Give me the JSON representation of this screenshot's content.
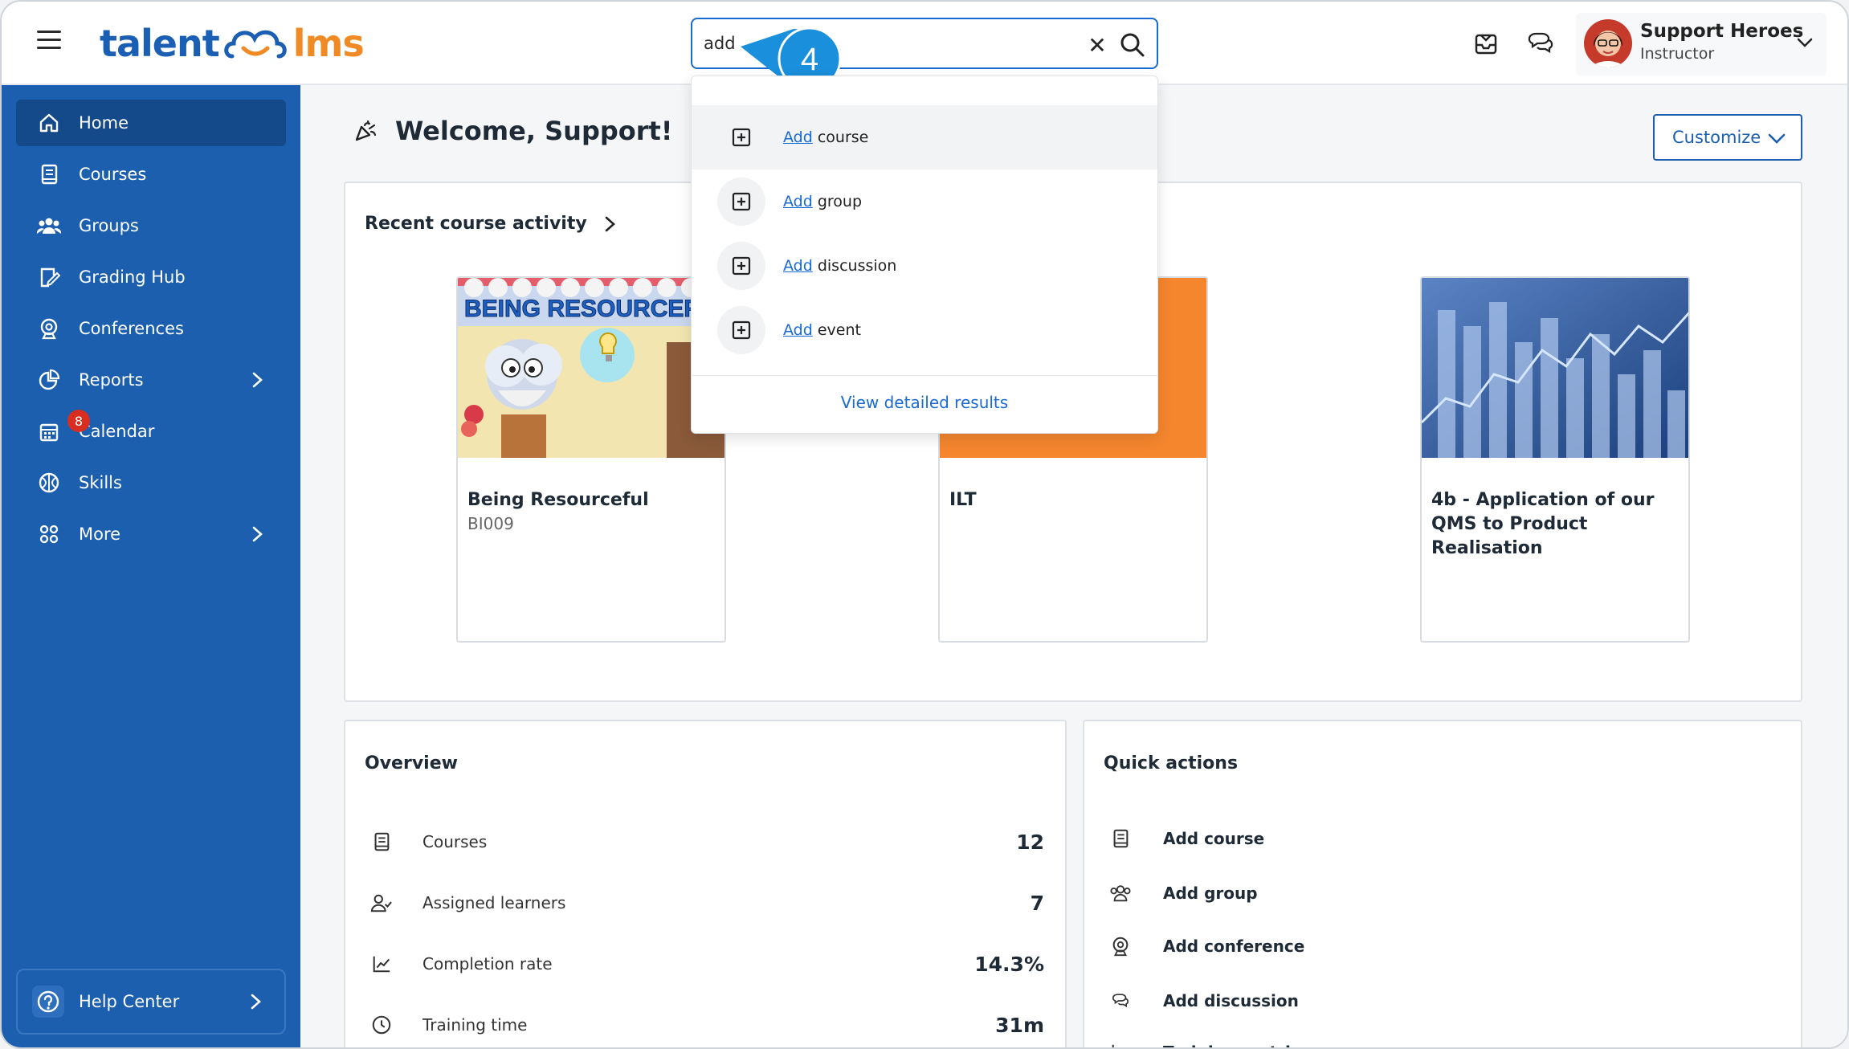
{
  "app": {
    "logo_left": "talent",
    "logo_right": "lms"
  },
  "search": {
    "value": "add",
    "placeholder": ""
  },
  "step_marker": "4",
  "user": {
    "name": "Support Heroes",
    "role": "Instructor"
  },
  "sidebar": {
    "items": [
      {
        "label": "Home",
        "icon": "home-icon",
        "active": true
      },
      {
        "label": "Courses",
        "icon": "book-icon"
      },
      {
        "label": "Groups",
        "icon": "users-icon"
      },
      {
        "label": "Grading Hub",
        "icon": "grading-icon"
      },
      {
        "label": "Conferences",
        "icon": "webcam-icon"
      },
      {
        "label": "Reports",
        "icon": "pie-chart-icon",
        "submenu": true
      },
      {
        "label": "Calendar",
        "icon": "calendar-icon",
        "badge": "8"
      },
      {
        "label": "Skills",
        "icon": "skills-icon"
      },
      {
        "label": "More",
        "icon": "grid-icon",
        "submenu": true
      }
    ],
    "help": "Help Center"
  },
  "main": {
    "welcome": "Welcome, Support!",
    "customize": "Customize",
    "recent": {
      "title": "Recent course activity",
      "courses": [
        {
          "title": "Being Resourceful",
          "code": "BI009",
          "thumb_text": "BEING RESOURCEFUL"
        },
        {
          "title": "ILT",
          "code": ""
        },
        {
          "title": "4b - Application of our QMS to Product Realisation",
          "code": ""
        }
      ]
    },
    "overview": {
      "title": "Overview",
      "rows": [
        {
          "label": "Courses",
          "value": "12"
        },
        {
          "label": "Assigned learners",
          "value": "7"
        },
        {
          "label": "Completion rate",
          "value": "14.3%"
        },
        {
          "label": "Training time",
          "value": "31m"
        }
      ]
    },
    "quick_actions": {
      "title": "Quick actions",
      "rows": [
        {
          "label": "Add course"
        },
        {
          "label": "Add group"
        },
        {
          "label": "Add conference"
        },
        {
          "label": "Add discussion"
        },
        {
          "label": "Training matrix"
        }
      ]
    }
  },
  "dropdown": {
    "items": [
      {
        "match": "Add",
        "rest": " course"
      },
      {
        "match": "Add",
        "rest": " group"
      },
      {
        "match": "Add",
        "rest": " discussion"
      },
      {
        "match": "Add",
        "rest": " event"
      }
    ],
    "view_all": "View detailed results"
  },
  "colors": {
    "brand_blue": "#1b5fae",
    "brand_orange": "#f08a24",
    "link": "#1a6bd1",
    "badge": "#d92d20",
    "ilt_thumb": "#f5862e"
  }
}
